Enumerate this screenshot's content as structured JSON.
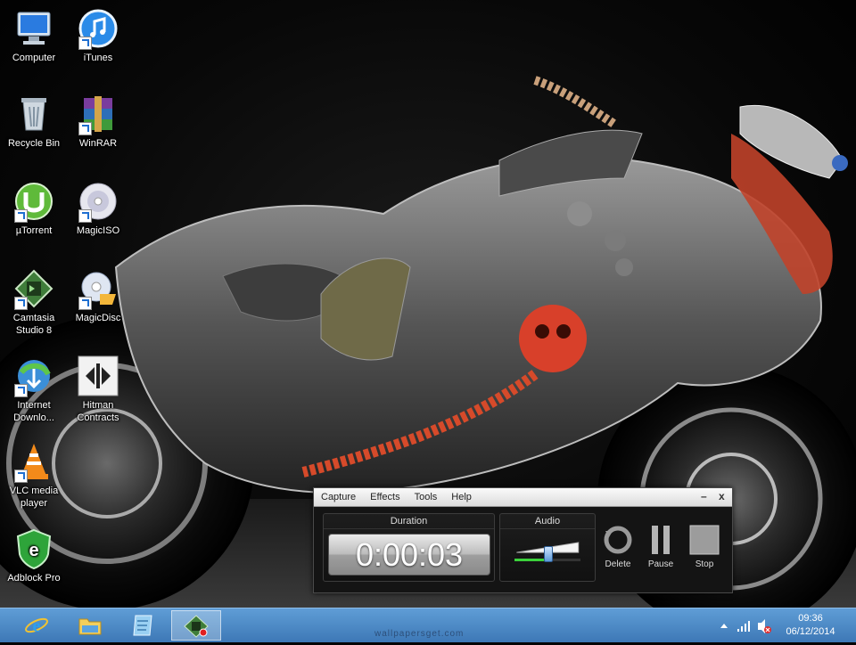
{
  "desktop": {
    "icons": [
      {
        "label": "Computer",
        "icon": "computer-icon"
      },
      {
        "label": "iTunes",
        "icon": "itunes-icon"
      },
      {
        "label": "Recycle Bin",
        "icon": "recycle-bin-icon"
      },
      {
        "label": "WinRAR",
        "icon": "winrar-icon"
      },
      {
        "label": "µTorrent",
        "icon": "utorrent-icon"
      },
      {
        "label": "MagicISO",
        "icon": "magiciso-icon"
      },
      {
        "label": "Camtasia Studio 8",
        "icon": "camtasia-icon"
      },
      {
        "label": "MagicDisc",
        "icon": "magicdisc-icon"
      },
      {
        "label": "Internet Downlo...",
        "icon": "idm-icon"
      },
      {
        "label": "Hitman Contracts",
        "icon": "hitman-icon"
      },
      {
        "label": "VLC media player",
        "icon": "vlc-icon"
      },
      {
        "label": "Adblock Pro",
        "icon": "adblock-icon"
      }
    ]
  },
  "recorder": {
    "menu": [
      "Capture",
      "Effects",
      "Tools",
      "Help"
    ],
    "minimize_label": "–",
    "close_label": "x",
    "duration_title": "Duration",
    "duration_value": "0:00:03",
    "audio_title": "Audio",
    "audio_level": 0.5,
    "delete_label": "Delete",
    "pause_label": "Pause",
    "stop_label": "Stop"
  },
  "taskbar": {
    "items": [
      "internet-explorer-icon",
      "file-explorer-icon",
      "notes-app-icon",
      "camtasia-recorder-icon"
    ],
    "clock_time": "09:36",
    "clock_date": "06/12/2014"
  },
  "watermark": "wallpapersget.com",
  "colors": {
    "taskbar": "#4a89c8",
    "timer_text": "#ffffff",
    "audio_level": "#3bd13b",
    "wallpaper_accent": "#d8402a"
  }
}
